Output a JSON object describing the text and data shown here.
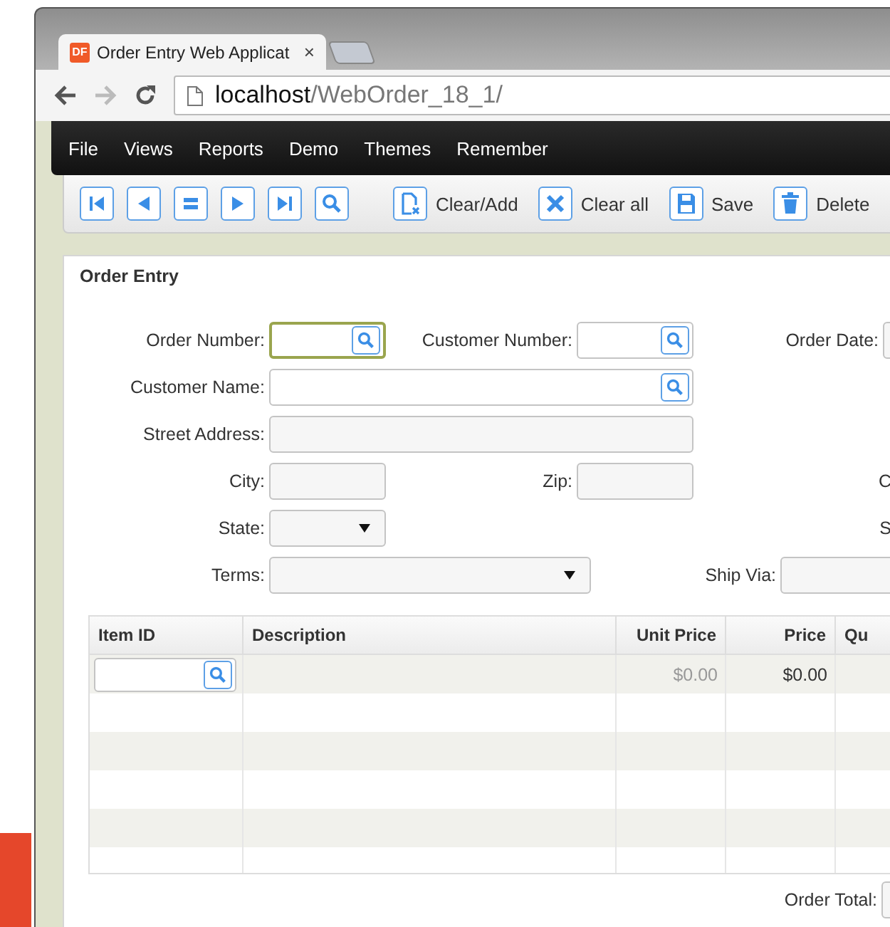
{
  "browser": {
    "favicon_text": "DF",
    "tab_title": "Order Entry Web Applicat",
    "tab_close": "×",
    "address_host": "localhost",
    "address_path": "/WebOrder_18_1/"
  },
  "menu": [
    "File",
    "Views",
    "Reports",
    "Demo",
    "Themes",
    "Remember"
  ],
  "toolbar": {
    "actions": [
      {
        "label": "Clear/Add"
      },
      {
        "label": "Clear all"
      },
      {
        "label": "Save"
      },
      {
        "label": "Delete"
      }
    ]
  },
  "form": {
    "title": "Order Entry",
    "rows": [
      [
        {
          "label": "Order Number:",
          "kind": "lookup",
          "focused": true
        },
        {
          "label": "Customer Number:",
          "kind": "lookup",
          "focused": false
        },
        {
          "label": "Order Date:",
          "kind": "text",
          "focused": false
        }
      ],
      [
        {
          "label": "Customer Name:",
          "kind": "lookup",
          "focused": false
        }
      ],
      [
        {
          "label": "Street Address:",
          "kind": "text",
          "focused": false
        }
      ],
      [
        {
          "label": "City:",
          "kind": "text",
          "focused": false
        },
        {
          "label": "Zip:",
          "kind": "text",
          "focused": false
        },
        {
          "label": "C",
          "kind": "label"
        }
      ],
      [
        {
          "label": "State:",
          "kind": "select",
          "focused": false
        },
        {
          "label": "S",
          "kind": "label"
        }
      ],
      [
        {
          "label": "Terms:",
          "kind": "select",
          "focused": false
        },
        {
          "label": "Ship Via:",
          "kind": "text",
          "focused": false
        }
      ]
    ]
  },
  "grid": {
    "columns": [
      {
        "label": "Item ID"
      },
      {
        "label": "Description"
      },
      {
        "label": "Unit Price"
      },
      {
        "label": "Price"
      },
      {
        "label": "Qu"
      }
    ],
    "entry_row": {
      "unit_price": "$0.00",
      "price": "$0.00"
    }
  },
  "order_total": {
    "label": "Order Total:"
  }
}
